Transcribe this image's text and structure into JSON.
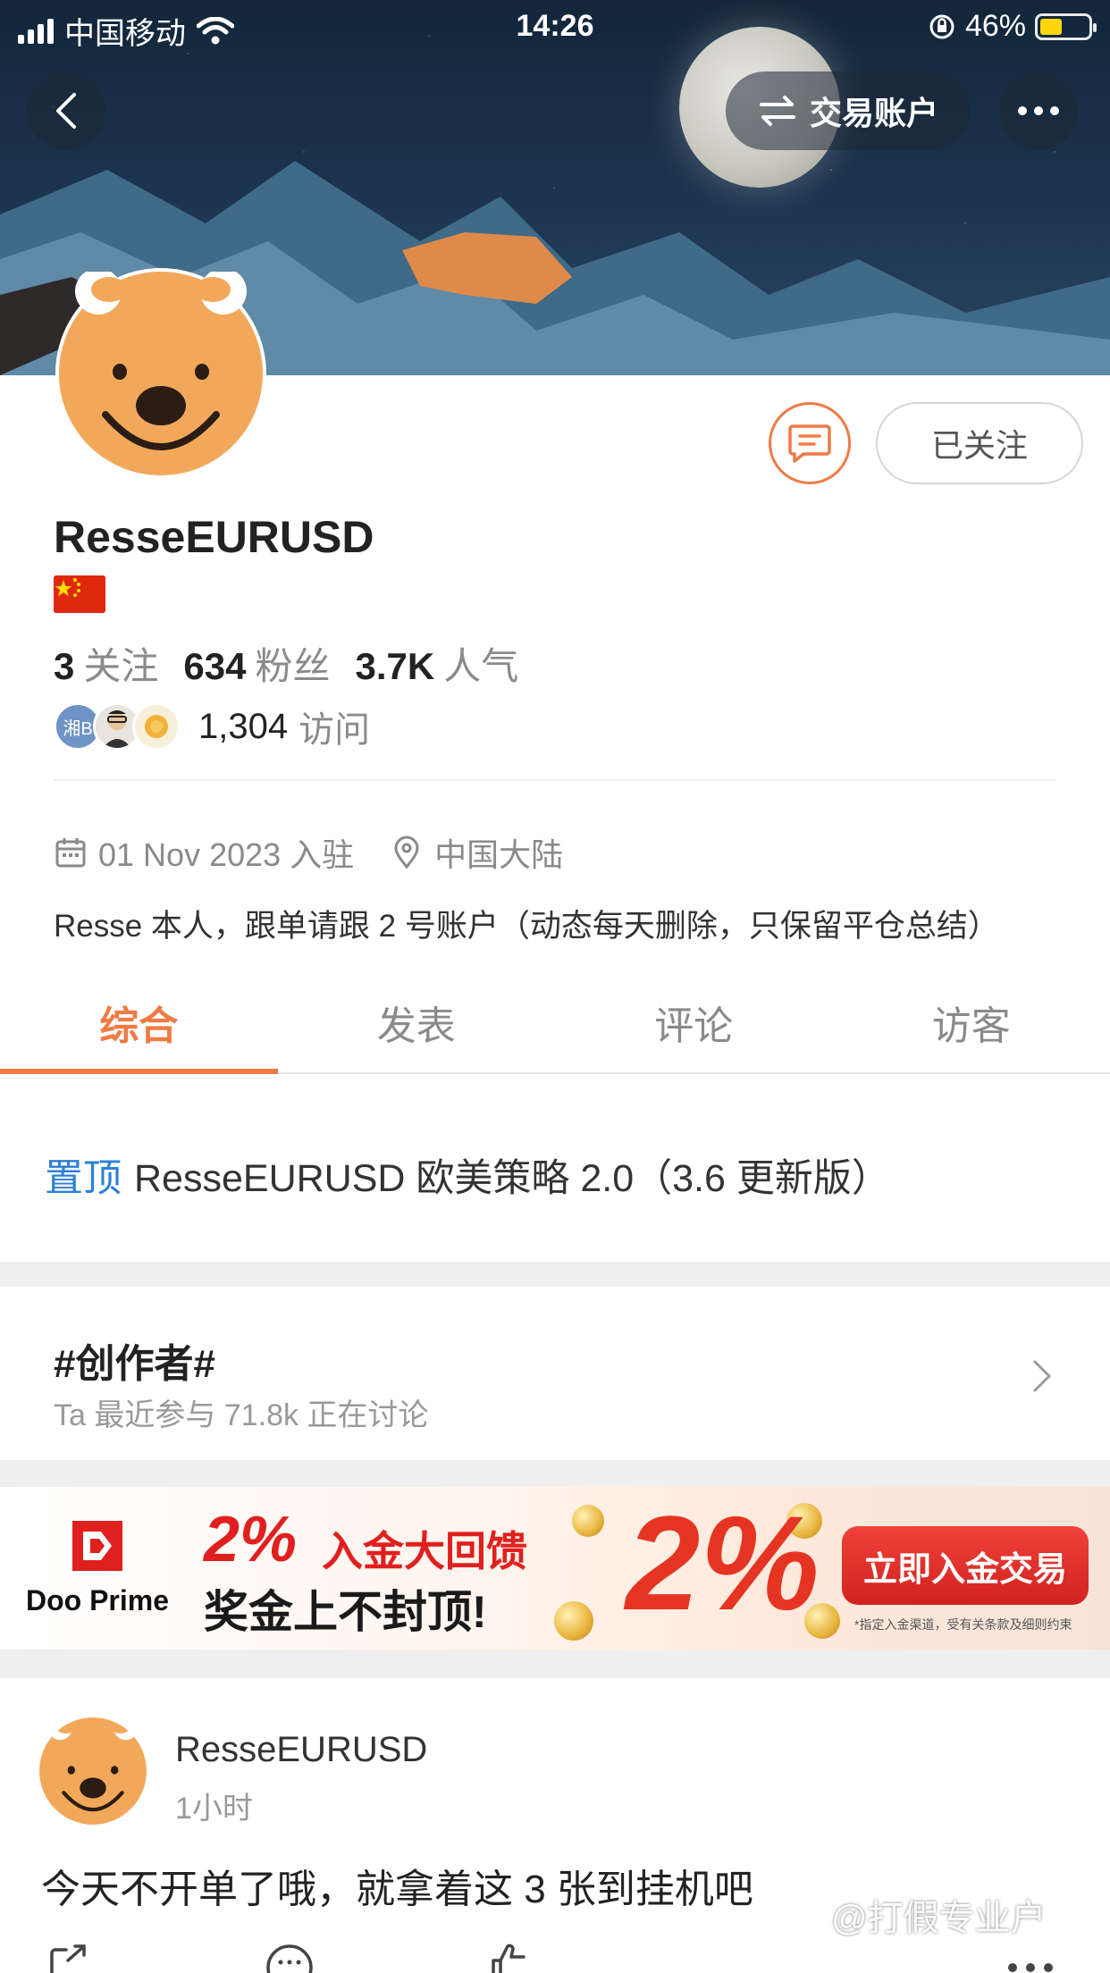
{
  "status_bar": {
    "carrier": "中国移动",
    "time": "14:26",
    "battery": "46%",
    "battery_level": 0.46
  },
  "header": {
    "trade_account_label": "交易账户"
  },
  "profile": {
    "username": "ResseEURUSD",
    "follow_button": "已关注",
    "stats": {
      "following_count": "3",
      "following_label": "关注",
      "fans_count": "634",
      "fans_label": "粉丝",
      "popularity_count": "3.7K",
      "popularity_label": "人气"
    },
    "visitors": {
      "first_avatar_text": "湘B",
      "count": "1,304",
      "label": "访问"
    },
    "joined": "01 Nov 2023 入驻",
    "location": "中国大陆",
    "bio": "Resse 本人，跟单请跟 2 号账户（动态每天删除，只保留平仓总结）"
  },
  "tabs": [
    {
      "label": "综合",
      "active": true
    },
    {
      "label": "发表",
      "active": false
    },
    {
      "label": "评论",
      "active": false
    },
    {
      "label": "访客",
      "active": false
    }
  ],
  "pinned": {
    "tag": "置顶",
    "title": "ResseEURUSD 欧美策略 2.0（3.6 更新版）"
  },
  "topic": {
    "title": "#创作者#",
    "subtitle": "Ta 最近参与  71.8k 正在讨论"
  },
  "banner": {
    "brand": "Doo Prime",
    "percent": "2%",
    "line1": "入金大回馈",
    "line2": "奖金上不封顶!",
    "big_text": "2%",
    "cta": "立即入金交易",
    "note": "*指定入金渠道，受有关条款及细则约束"
  },
  "post": {
    "author": "ResseEURUSD",
    "time": "1小时",
    "text": "今天不开单了哦，就拿着这 3 张到挂机吧"
  },
  "watermark": "@打假专业户",
  "colors": {
    "accent": "#f07a45",
    "pin_blue": "#2b80d6",
    "banner_red": "#e0201f"
  },
  "icons": [
    "back-icon",
    "swap-icon",
    "more-icon",
    "message-icon",
    "calendar-icon",
    "location-icon",
    "chevron-right-icon",
    "share-icon",
    "comment-icon",
    "like-icon"
  ]
}
